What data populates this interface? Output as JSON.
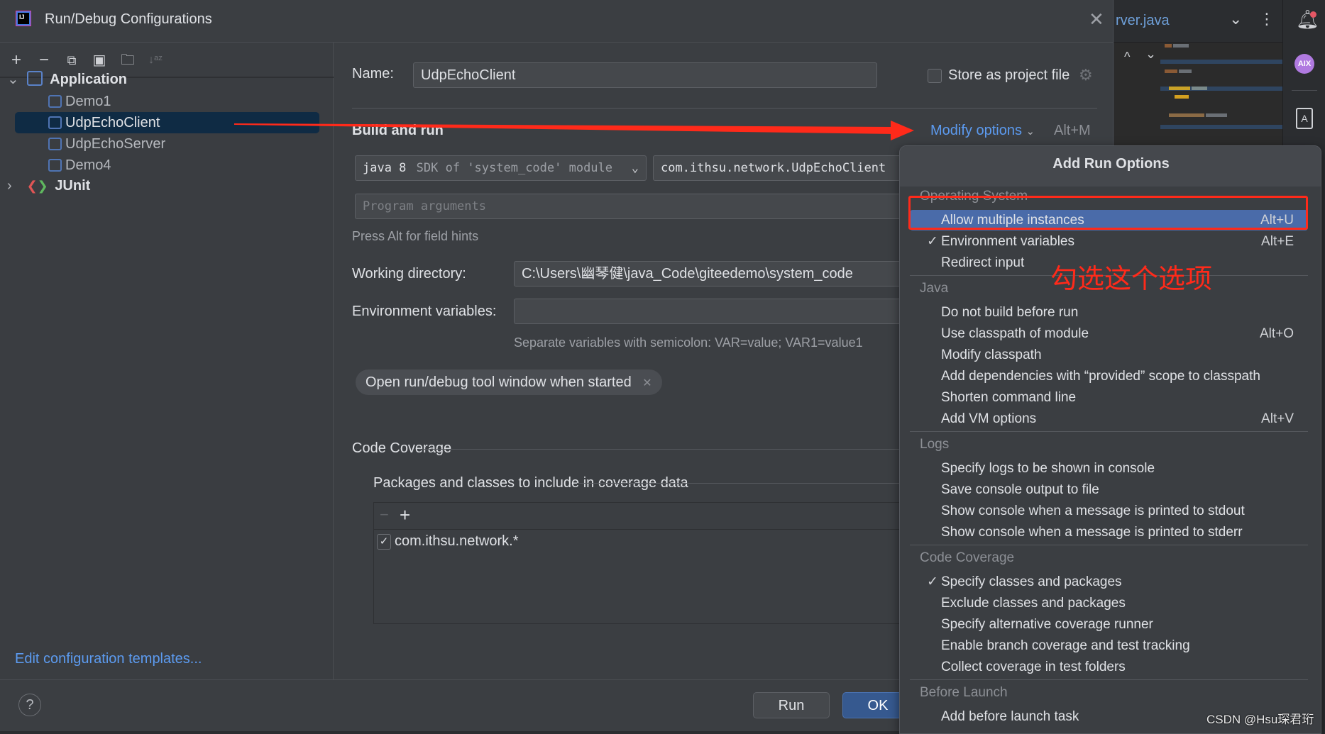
{
  "window": {
    "title": "Run/Debug Configurations",
    "close_icon": "close-icon"
  },
  "toolbar": {
    "icons": [
      "add-icon",
      "remove-icon",
      "copy-icon",
      "save-icon",
      "new-folder-icon",
      "sort-icon"
    ]
  },
  "tree": {
    "application": "Application",
    "items": [
      "Demo1",
      "UdpEchoClient",
      "UdpEchoServer",
      "Demo4"
    ],
    "selected": "UdpEchoClient",
    "junit": "JUnit"
  },
  "left_footer": {
    "edit_templates": "Edit configuration templates...",
    "help": "?"
  },
  "form": {
    "name_label": "Name:",
    "name_value": "UdpEchoClient",
    "store_label": "Store as project file",
    "store_checked": false,
    "build_run": "Build and run",
    "modify_options": "Modify options",
    "modify_shortcut": "Alt+M",
    "sdk_main": "java 8",
    "sdk_sub": "SDK of 'system_code' module",
    "main_class": "com.ithsu.network.UdpEchoClient",
    "program_args_placeholder": "Program arguments",
    "field_hint": "Press Alt for field hints",
    "workdir_label": "Working directory:",
    "workdir_value": "C:\\Users\\幽琴健\\java_Code\\giteedemo\\system_code",
    "env_label": "Environment variables:",
    "env_value": "",
    "env_hint": "Separate variables with semicolon: VAR=value; VAR1=value1",
    "chip": "Open run/debug tool window when started",
    "coverage_title": "Code Coverage",
    "packages_title": "Packages and classes to include in coverage data",
    "package_item": "com.ithsu.network.*",
    "package_checked": true
  },
  "buttons": {
    "run": "Run",
    "ok": "OK"
  },
  "popup": {
    "title": "Add Run Options",
    "sections": [
      {
        "header": "Operating System",
        "items": [
          {
            "label": "Allow multiple instances",
            "shortcut": "Alt+U",
            "checked": false,
            "highlighted": true
          },
          {
            "label": "Environment variables",
            "shortcut": "Alt+E",
            "checked": true
          },
          {
            "label": "Redirect input",
            "shortcut": "",
            "checked": false
          }
        ]
      },
      {
        "header": "Java",
        "items": [
          {
            "label": "Do not build before run",
            "shortcut": "",
            "checked": false
          },
          {
            "label": "Use classpath of module",
            "shortcut": "Alt+O",
            "checked": false
          },
          {
            "label": "Modify classpath",
            "shortcut": "",
            "checked": false
          },
          {
            "label": "Add dependencies with “provided” scope to classpath",
            "shortcut": "",
            "checked": false
          },
          {
            "label": "Shorten command line",
            "shortcut": "",
            "checked": false
          },
          {
            "label": "Add VM options",
            "shortcut": "Alt+V",
            "checked": false
          }
        ]
      },
      {
        "header": "Logs",
        "items": [
          {
            "label": "Specify logs to be shown in console",
            "shortcut": "",
            "checked": false
          },
          {
            "label": "Save console output to file",
            "shortcut": "",
            "checked": false
          },
          {
            "label": "Show console when a message is printed to stdout",
            "shortcut": "",
            "checked": false
          },
          {
            "label": "Show console when a message is printed to stderr",
            "shortcut": "",
            "checked": false
          }
        ]
      },
      {
        "header": "Code Coverage",
        "items": [
          {
            "label": "Specify classes and packages",
            "shortcut": "",
            "checked": true
          },
          {
            "label": "Exclude classes and packages",
            "shortcut": "",
            "checked": false
          },
          {
            "label": "Specify alternative coverage runner",
            "shortcut": "",
            "checked": false
          },
          {
            "label": "Enable branch coverage and test tracking",
            "shortcut": "",
            "checked": false
          },
          {
            "label": "Collect coverage in test folders",
            "shortcut": "",
            "checked": false
          }
        ]
      },
      {
        "header": "Before Launch",
        "items": [
          {
            "label": "Add before launch task",
            "shortcut": "",
            "checked": false
          }
        ]
      }
    ]
  },
  "annotation": {
    "text": "勾选这个选项",
    "color": "#ff2a1a"
  },
  "editor": {
    "tab": "rver.java"
  },
  "watermark": "CSDN @Hsu琛君珩",
  "colors": {
    "accent": "#4a6ba9",
    "link": "#5c9bf0",
    "selection": "#0f2b44",
    "annotation": "#ff2a1a"
  }
}
